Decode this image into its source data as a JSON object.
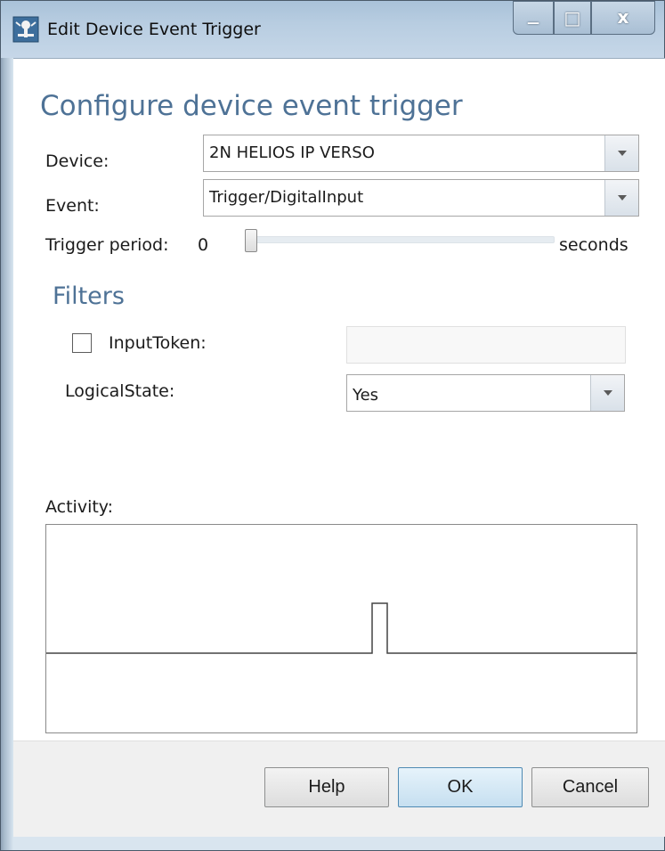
{
  "window": {
    "title": "Edit Device Event Trigger",
    "controls": {
      "minimize": "—",
      "maximize": "□",
      "close": "x"
    }
  },
  "main": {
    "heading": "Configure device event trigger",
    "device_label": "Device:",
    "device_value": "2N HELIOS IP VERSO",
    "event_label": "Event:",
    "event_value": "Trigger/DigitalInput",
    "trigger_period_label": "Trigger period:",
    "trigger_period_value": "0",
    "trigger_period_unit": "seconds",
    "trigger_period_slider_fraction": 0.0
  },
  "filters": {
    "heading": "Filters",
    "input_token_label": "InputToken:",
    "input_token_checked": false,
    "input_token_value": "",
    "logical_state_label": "LogicalState:",
    "logical_state_value": "Yes"
  },
  "activity": {
    "label": "Activity:",
    "pulse_count": 1
  },
  "footer": {
    "help_label": "Help",
    "ok_label": "OK",
    "cancel_label": "Cancel"
  },
  "colors": {
    "heading": "#4e7296",
    "titlebar": "#b8cde1",
    "footer": "#f0f0f0",
    "ok_button_border": "#4f8ab3"
  }
}
